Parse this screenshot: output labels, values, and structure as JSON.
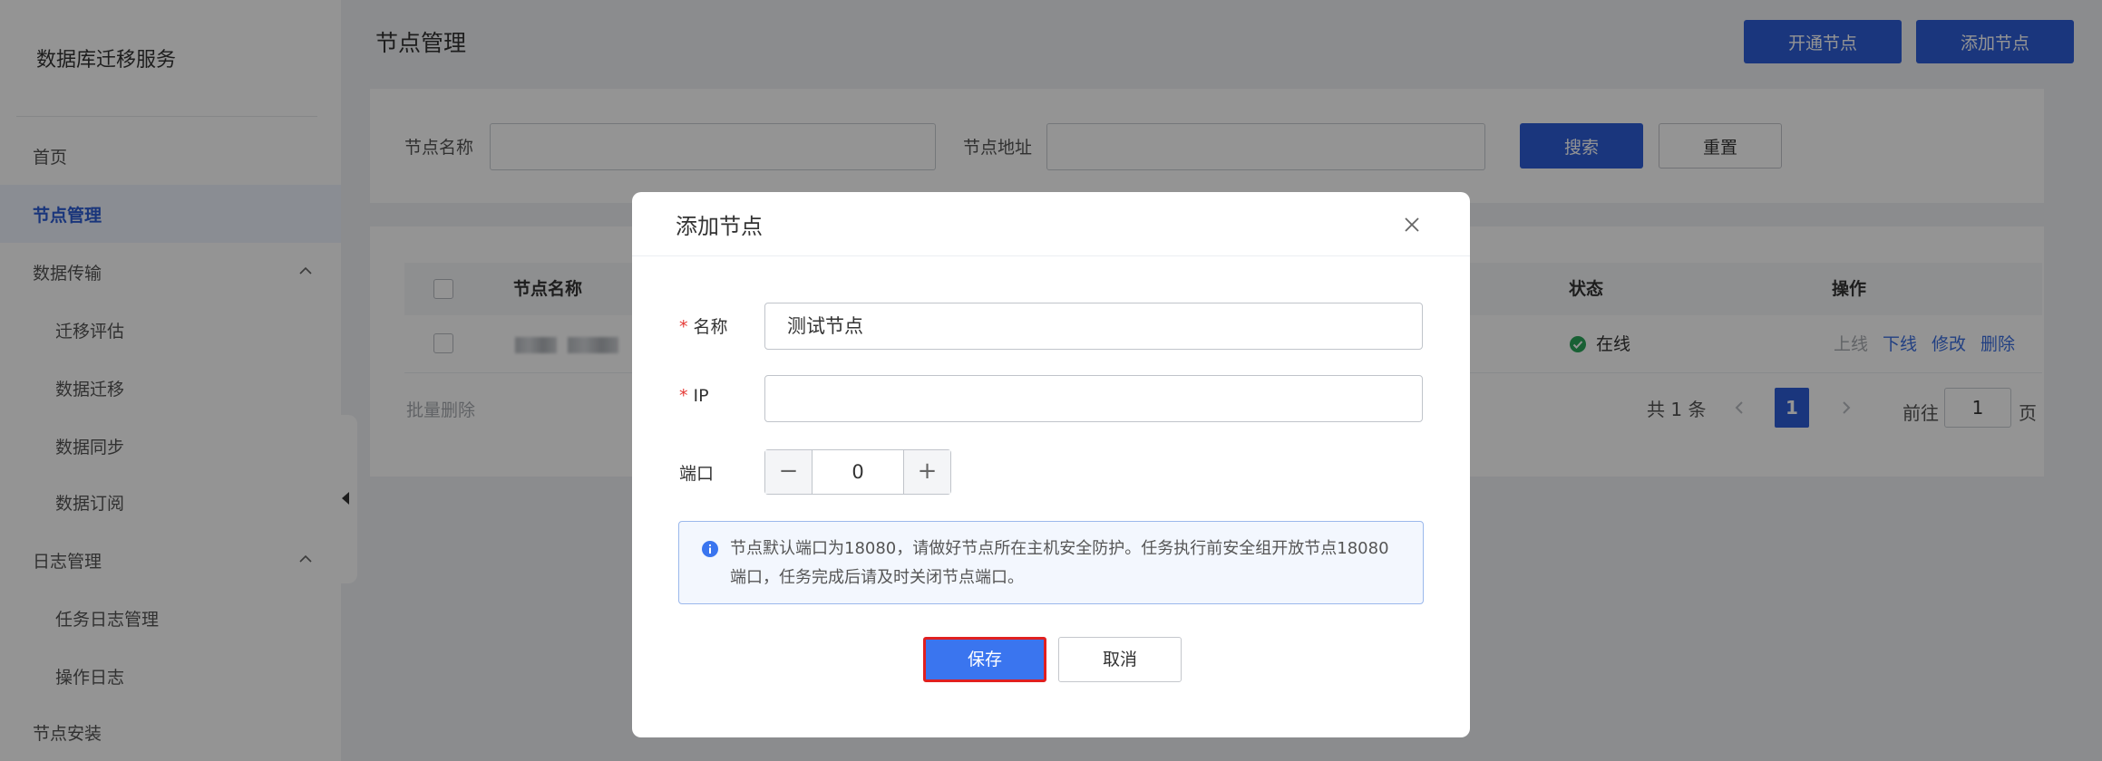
{
  "sidebar": {
    "app_title": "数据库迁移服务",
    "items": [
      {
        "label": "首页"
      },
      {
        "label": "节点管理"
      },
      {
        "label": "数据传输"
      },
      {
        "label": "迁移评估"
      },
      {
        "label": "数据迁移"
      },
      {
        "label": "数据同步"
      },
      {
        "label": "数据订阅"
      },
      {
        "label": "日志管理"
      },
      {
        "label": "任务日志管理"
      },
      {
        "label": "操作日志"
      },
      {
        "label": "节点安装"
      }
    ]
  },
  "header": {
    "title": "节点管理",
    "open_node_button": "开通节点",
    "add_node_button": "添加节点"
  },
  "search": {
    "name_label": "节点名称",
    "address_label": "节点地址",
    "search_button": "搜索",
    "reset_button": "重置"
  },
  "table": {
    "columns": [
      "节点名称",
      "状态",
      "操作"
    ],
    "rows": [
      {
        "status": "在线",
        "actions": [
          "上线",
          "下线",
          "修改",
          "删除"
        ]
      }
    ],
    "batch_delete": "批量删除"
  },
  "pagination": {
    "total": "共 1 条",
    "current_page": "1",
    "goto_label": "前往",
    "goto_value": "1",
    "page_suffix": "页"
  },
  "modal": {
    "title": "添加节点",
    "name_label": "名称",
    "name_value": "测试节点",
    "ip_label": "IP",
    "ip_value": "",
    "port_label": "端口",
    "port_value": "0",
    "alert_text": "节点默认端口为18080，请做好节点所在主机安全防护。任务执行前安全组开放节点18080端口，任务完成后请及时关闭节点端口。",
    "save_button": "保存",
    "cancel_button": "取消"
  },
  "colors": {
    "primary": "#2d5dd7",
    "active_nav": "#2c5cd4",
    "success": "#2aa55a",
    "required": "#e53935",
    "highlight_border": "#e02020"
  },
  "icons": [
    "chevron-up-icon",
    "collapse-arrow-icon",
    "check-circle-icon",
    "chevron-left-icon",
    "chevron-right-icon",
    "close-icon",
    "info-icon"
  ]
}
